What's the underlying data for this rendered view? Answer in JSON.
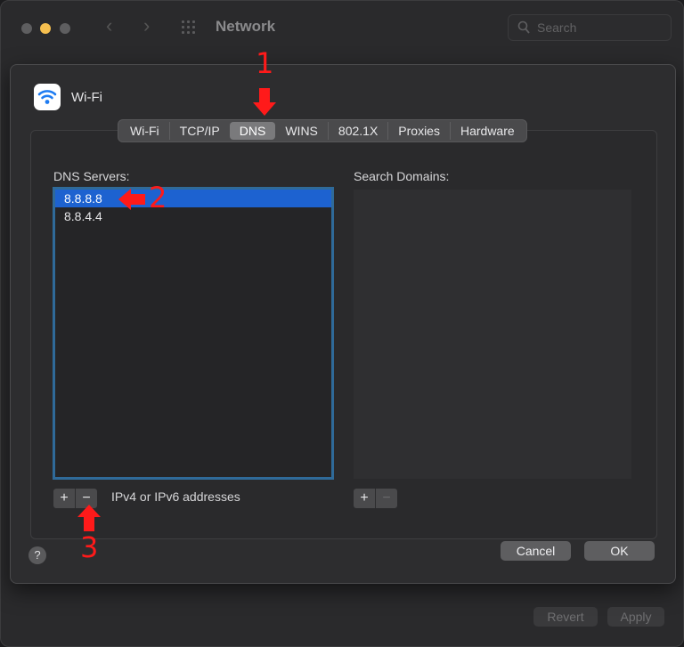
{
  "window": {
    "title": "Network",
    "search_placeholder": "Search",
    "revert_label": "Revert",
    "apply_label": "Apply"
  },
  "sheet": {
    "title": "Wi-Fi",
    "tabs": [
      "Wi-Fi",
      "TCP/IP",
      "DNS",
      "WINS",
      "802.1X",
      "Proxies",
      "Hardware"
    ],
    "active_tab": "DNS",
    "dns_servers_label": "DNS Servers:",
    "dns_servers": [
      "8.8.8.8",
      "8.8.4.4"
    ],
    "selected_dns": "8.8.8.8",
    "search_domains_label": "Search Domains:",
    "search_domains": [],
    "hint": "IPv4 or IPv6 addresses",
    "add_symbol": "+",
    "remove_symbol": "−",
    "help_symbol": "?",
    "cancel_label": "Cancel",
    "ok_label": "OK"
  },
  "annotations": {
    "step1": "1",
    "step2": "2",
    "step3": "3",
    "color": "#ff1a1a"
  },
  "colors": {
    "selection": "#1d62d0",
    "focus_ring": "#2f6a99",
    "window_bg": "#2a2a2c"
  }
}
